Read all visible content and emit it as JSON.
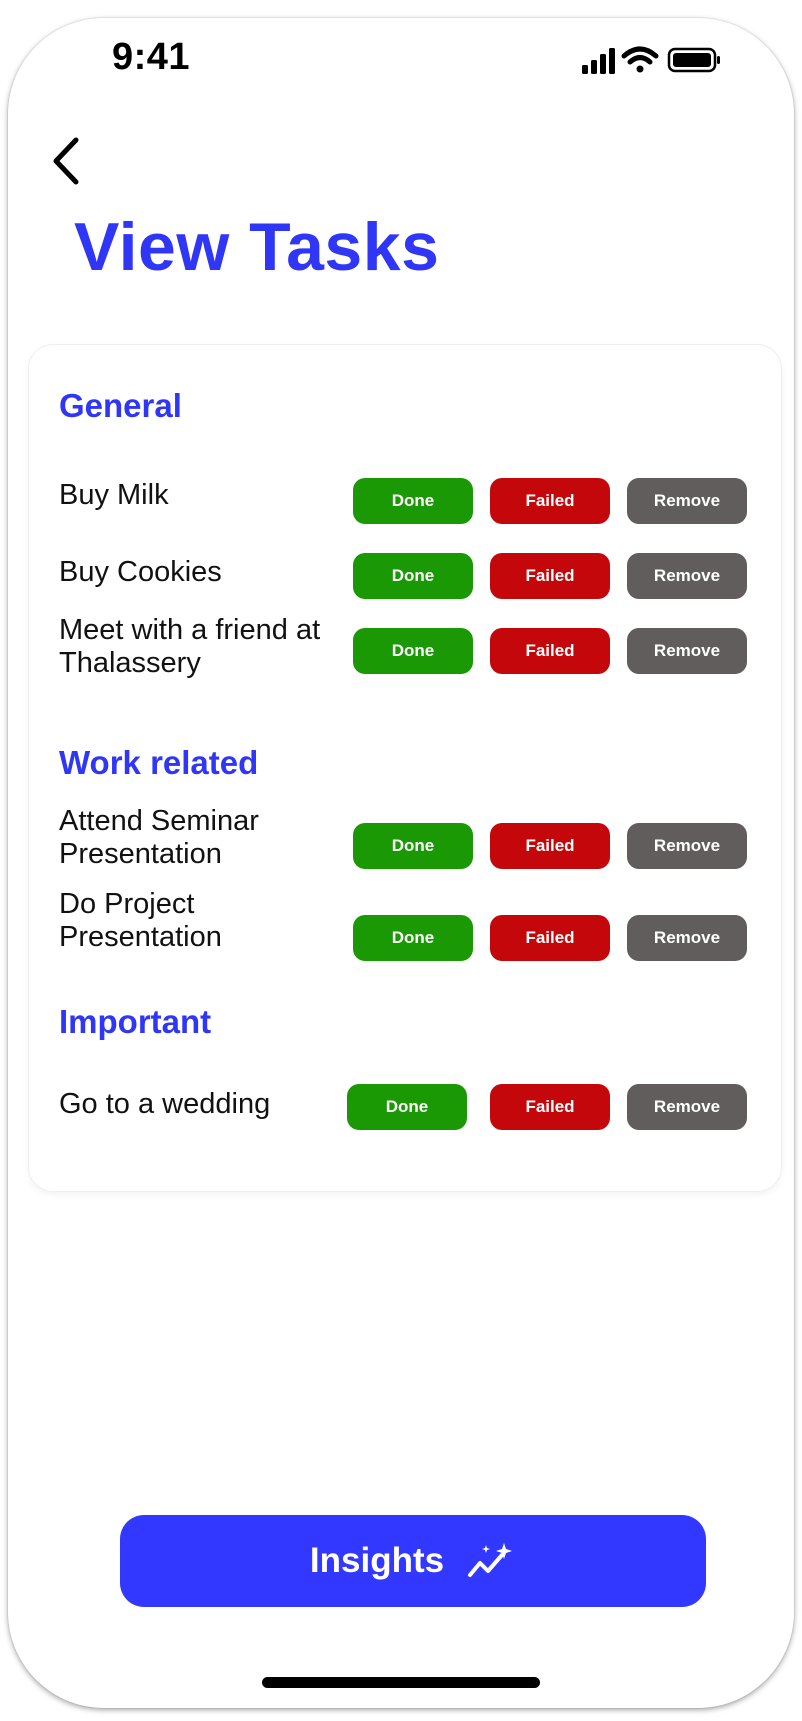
{
  "status_bar": {
    "time": "9:41"
  },
  "header": {
    "title": "View Tasks"
  },
  "sections": [
    {
      "title": "General",
      "tasks": [
        {
          "name": "Buy Milk"
        },
        {
          "name": "Buy Cookies"
        },
        {
          "name": "Meet with a friend at Thalassery"
        }
      ]
    },
    {
      "title": "Work related",
      "tasks": [
        {
          "name": "Attend Seminar Presentation"
        },
        {
          "name": "Do Project Presentation"
        }
      ]
    },
    {
      "title": "Important",
      "tasks": [
        {
          "name": "Go to a wedding"
        }
      ]
    }
  ],
  "actions": {
    "done": "Done",
    "failed": "Failed",
    "remove": "Remove"
  },
  "footer": {
    "insights_label": "Insights",
    "insights_icon": "sparkle-chart-icon"
  },
  "colors": {
    "accent": "#3238ff",
    "title": "#2f36f5",
    "done": "#1a9905",
    "failed": "#c4070a",
    "remove": "#625d5d"
  }
}
